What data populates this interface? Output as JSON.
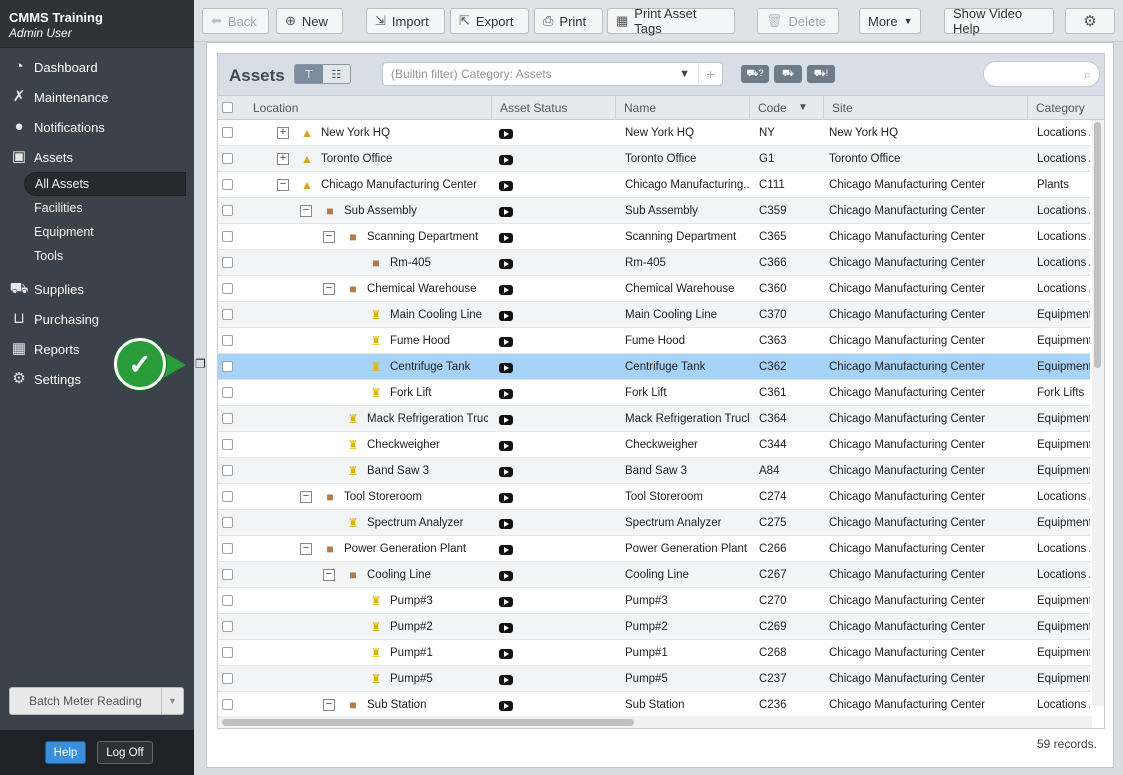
{
  "app": {
    "title": "CMMS Training",
    "user": "Admin User"
  },
  "nav": {
    "items": [
      {
        "label": "Dashboard",
        "icon": "dashboard-icon"
      },
      {
        "label": "Maintenance",
        "icon": "tools-icon"
      },
      {
        "label": "Notifications",
        "icon": "speech-bubble-icon"
      },
      {
        "label": "Assets",
        "icon": "boxes-icon"
      }
    ],
    "sub_items": [
      "All Assets",
      "Facilities",
      "Equipment",
      "Tools"
    ],
    "items2": [
      {
        "label": "Supplies",
        "icon": "truck-icon"
      },
      {
        "label": "Purchasing",
        "icon": "cart-icon"
      },
      {
        "label": "Reports",
        "icon": "chart-icon"
      },
      {
        "label": "Settings",
        "icon": "gear-icon"
      }
    ]
  },
  "batch_label": "Batch Meter Reading",
  "footer": {
    "help": "Help",
    "logoff": "Log Off"
  },
  "toolbar": {
    "back": "Back",
    "new": "New",
    "import": "Import",
    "export": "Export",
    "print": "Print",
    "print_tags": "Print Asset Tags",
    "delete": "Delete",
    "more": "More",
    "video": "Show Video Help"
  },
  "grid": {
    "title": "Assets",
    "filter": "(Builtin filter) Category: Assets",
    "records": "59 records.",
    "columns": [
      "Location",
      "Asset Status",
      "Name",
      "Code",
      "Site",
      "Category"
    ]
  },
  "rows": [
    {
      "loc": "New York HQ",
      "depth": 0,
      "tog": "+",
      "icon": "site",
      "name": "New York HQ",
      "code": "NY",
      "site": "New York HQ",
      "cat": "Locations /"
    },
    {
      "loc": "Toronto Office",
      "depth": 0,
      "tog": "+",
      "icon": "site",
      "name": "Toronto Office",
      "code": "G1",
      "site": "Toronto Office",
      "cat": "Locations /"
    },
    {
      "loc": "Chicago Manufacturing Center",
      "depth": 0,
      "tog": "−",
      "icon": "site",
      "name": "Chicago Manufacturing...",
      "code": "C111",
      "site": "Chicago Manufacturing Center",
      "cat": "Plants"
    },
    {
      "loc": "Sub Assembly",
      "depth": 1,
      "tog": "−",
      "icon": "bldg",
      "name": "Sub Assembly",
      "code": "C359",
      "site": "Chicago Manufacturing Center",
      "cat": "Locations /"
    },
    {
      "loc": "Scanning Department",
      "depth": 2,
      "tog": "−",
      "icon": "bldg",
      "name": "Scanning Department",
      "code": "C365",
      "site": "Chicago Manufacturing Center",
      "cat": "Locations /"
    },
    {
      "loc": "Rm-405",
      "depth": 3,
      "tog": "",
      "icon": "bldg",
      "name": "Rm-405",
      "code": "C366",
      "site": "Chicago Manufacturing Center",
      "cat": "Locations /"
    },
    {
      "loc": "Chemical Warehouse",
      "depth": 2,
      "tog": "−",
      "icon": "bldg",
      "name": "Chemical Warehouse",
      "code": "C360",
      "site": "Chicago Manufacturing Center",
      "cat": "Locations /"
    },
    {
      "loc": "Main Cooling Line",
      "depth": 3,
      "tog": "",
      "icon": "equip",
      "name": "Main Cooling Line",
      "code": "C370",
      "site": "Chicago Manufacturing Center",
      "cat": "Equipment"
    },
    {
      "loc": "Fume Hood",
      "depth": 3,
      "tog": "",
      "icon": "equip",
      "name": "Fume Hood",
      "code": "C363",
      "site": "Chicago Manufacturing Center",
      "cat": "Equipment"
    },
    {
      "loc": "Centrifuge Tank",
      "depth": 3,
      "tog": "",
      "icon": "equip",
      "name": "Centrifuge Tank",
      "code": "C362",
      "site": "Chicago Manufacturing Center",
      "cat": "Equipment",
      "sel": true
    },
    {
      "loc": "Fork Lift",
      "depth": 3,
      "tog": "",
      "icon": "equip",
      "name": "Fork Lift",
      "code": "C361",
      "site": "Chicago Manufacturing Center",
      "cat": "Fork Lifts"
    },
    {
      "loc": "Mack Refrigeration Truck",
      "depth": 2,
      "tog": "",
      "icon": "equip",
      "name": "Mack Refrigeration Truck",
      "code": "C364",
      "site": "Chicago Manufacturing Center",
      "cat": "Equipment"
    },
    {
      "loc": "Checkweigher",
      "depth": 2,
      "tog": "",
      "icon": "equip",
      "name": "Checkweigher",
      "code": "C344",
      "site": "Chicago Manufacturing Center",
      "cat": "Equipment"
    },
    {
      "loc": "Band Saw 3",
      "depth": 2,
      "tog": "",
      "icon": "equip",
      "name": "Band Saw 3",
      "code": "A84",
      "site": "Chicago Manufacturing Center",
      "cat": "Equipment"
    },
    {
      "loc": "Tool Storeroom",
      "depth": 1,
      "tog": "−",
      "icon": "bldg",
      "name": "Tool Storeroom",
      "code": "C274",
      "site": "Chicago Manufacturing Center",
      "cat": "Locations /"
    },
    {
      "loc": "Spectrum Analyzer",
      "depth": 2,
      "tog": "",
      "icon": "equip",
      "name": "Spectrum Analyzer",
      "code": "C275",
      "site": "Chicago Manufacturing Center",
      "cat": "Equipment"
    },
    {
      "loc": "Power Generation Plant",
      "depth": 1,
      "tog": "−",
      "icon": "bldg",
      "name": "Power Generation Plant",
      "code": "C266",
      "site": "Chicago Manufacturing Center",
      "cat": "Locations /"
    },
    {
      "loc": "Cooling Line",
      "depth": 2,
      "tog": "−",
      "icon": "bldg",
      "name": "Cooling Line",
      "code": "C267",
      "site": "Chicago Manufacturing Center",
      "cat": "Locations /"
    },
    {
      "loc": "Pump#3",
      "depth": 3,
      "tog": "",
      "icon": "equip",
      "name": "Pump#3",
      "code": "C270",
      "site": "Chicago Manufacturing Center",
      "cat": "Equipment"
    },
    {
      "loc": "Pump#2",
      "depth": 3,
      "tog": "",
      "icon": "equip",
      "name": "Pump#2",
      "code": "C269",
      "site": "Chicago Manufacturing Center",
      "cat": "Equipment"
    },
    {
      "loc": "Pump#1",
      "depth": 3,
      "tog": "",
      "icon": "equip",
      "name": "Pump#1",
      "code": "C268",
      "site": "Chicago Manufacturing Center",
      "cat": "Equipment"
    },
    {
      "loc": "Pump#5",
      "depth": 3,
      "tog": "",
      "icon": "equip",
      "name": "Pump#5",
      "code": "C237",
      "site": "Chicago Manufacturing Center",
      "cat": "Equipment"
    },
    {
      "loc": "Sub Station",
      "depth": 2,
      "tog": "−",
      "icon": "bldg",
      "name": "Sub Station",
      "code": "C236",
      "site": "Chicago Manufacturing Center",
      "cat": "Locations /"
    }
  ]
}
